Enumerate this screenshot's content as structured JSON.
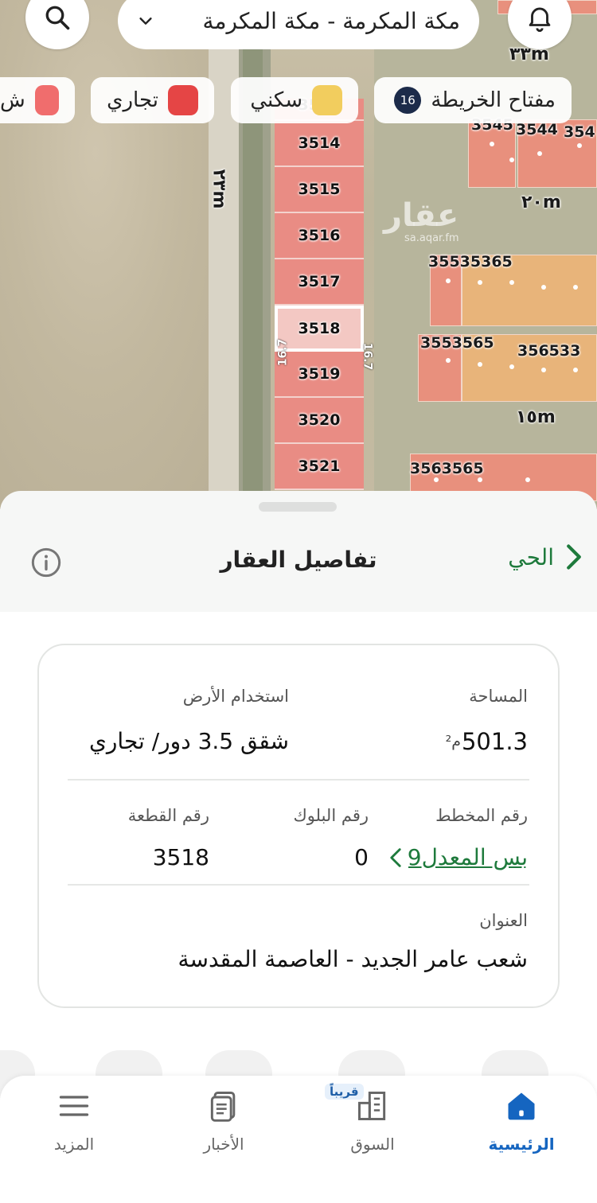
{
  "map": {
    "location_text": "مكة المكرمة - مكة المكرمة",
    "legend_chips": [
      {
        "label": "مفتاح الخريطة",
        "badge": "16"
      },
      {
        "label": "سكني",
        "color": "#f2cd5e"
      },
      {
        "label": "تجاري",
        "color": "#e54545"
      },
      {
        "label": "ش",
        "color": "#f06d6d"
      }
    ],
    "parcels": [
      "3514",
      "3515",
      "3516",
      "3517",
      "3518",
      "3519",
      "3520",
      "3521"
    ],
    "parcel_top_partial": "3513",
    "selected_parcel": "3518",
    "street_labels": [
      "٣٣m",
      "٢٠m",
      "٢٣m",
      "١٥m"
    ],
    "dimension_labels": [
      "16.7",
      "16.7"
    ],
    "block_labels": [
      "3545",
      "3544",
      "354",
      "35535365",
      "3553565",
      "356533",
      "3563565"
    ],
    "watermark": "عقار",
    "watermark_url": "sa.aqar.fm"
  },
  "sheet": {
    "back_label": "الحي",
    "title": "تفاصيل العقار",
    "area_label": "المساحة",
    "area_value": "501.3",
    "area_unit": "م²",
    "land_use_label": "استخدام الأرض",
    "land_use_value": "شقق 3.5 دور/ تجاري",
    "plan_label": "رقم المخطط",
    "plan_value": "بس المعدل9",
    "block_label": "رقم البلوك",
    "block_value": "0",
    "plot_label": "رقم القطعة",
    "plot_value": "3518",
    "address_label": "العنوان",
    "address_value": "شعب عامر الجديد - العاصمة المقدسة"
  },
  "nav": {
    "home": "الرئيسية",
    "market": "السوق",
    "soon_badge": "قريباً",
    "news": "الأخبار",
    "more": "المزيد"
  },
  "colors": {
    "accent_green": "#1e7a3c",
    "active_blue": "#1565c0",
    "parcel_commercial": "#e98c84"
  }
}
